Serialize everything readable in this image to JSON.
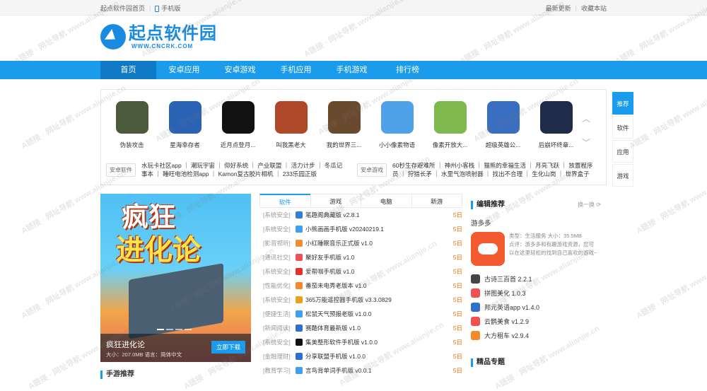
{
  "topbar": {
    "home_link": "起点软件园首页",
    "mobile_link": "手机版",
    "latest_link": "最新更新",
    "bookmark_link": "收藏本站"
  },
  "logo": {
    "name": "起点软件园",
    "url_text": "WWW.CNCRK.COM"
  },
  "nav": {
    "items": [
      "首页",
      "安卓应用",
      "安卓游戏",
      "手机应用",
      "手机游戏",
      "排行榜"
    ],
    "active": "首页"
  },
  "featured_apps": [
    {
      "name": "伪装攻击",
      "color": "#4a5a3a"
    },
    {
      "name": "星海幸存者",
      "color": "#2a62b4"
    },
    {
      "name": "近月点登月...",
      "color": "#111111"
    },
    {
      "name": "叫我黑老大",
      "color": "#b0482a"
    },
    {
      "name": "我的世界三...",
      "color": "#6a4a2f"
    },
    {
      "name": "小小像素物语",
      "color": "#4fa2e8"
    },
    {
      "name": "像素开放大...",
      "color": "#7fb84f"
    },
    {
      "name": "超级英雄公...",
      "color": "#3a6ec0"
    },
    {
      "name": "后崩坏终章...",
      "color": "#1e2c4a"
    }
  ],
  "tag_rows": [
    {
      "label": "安卓软件",
      "text": "水玩卡社区app ｜ 潮玩宇宙 ｜ 仰好系统 ｜ 产业联盟 ｜ 活力计步 ｜ 冬瓜记事本 ｜ 睡旺电池检测app ｜ Kamon复古胶片相机 ｜ 233乐园正版"
    },
    {
      "label": "安卓游戏",
      "text": "60秒生存避难所 ｜ 神州小客栈 ｜ 猫熊的幸福生活 ｜ 月亮飞跃 ｜ 放置程序员 ｜ 狩猎长矛 ｜ 水里气泡喷射器 ｜ 找出不合理 ｜ 生化山岗 ｜ 世界盒子"
    }
  ],
  "side_tabs": [
    "推荐",
    "软件",
    "应用",
    "游戏"
  ],
  "banner": {
    "title_line1": "疯狂",
    "title_line2": "进化论",
    "caption": "疯狂进化论",
    "meta": "大小：207.0MB   语言：简体中文",
    "download": "立即下载"
  },
  "list_tabs": [
    "软件",
    "游戏",
    "电脑",
    "新游"
  ],
  "list_items": [
    {
      "cat": "[系统安全]",
      "name": "笔趣阁典藏版 v2.8.1",
      "date": "5日",
      "color": "#2e7fd8"
    },
    {
      "cat": "[系统安全]",
      "name": "小熊画画手机版 v20240219.1",
      "date": "5日",
      "color": "#3aa0f0"
    },
    {
      "cat": "[影音视听]",
      "name": "小红睡眠音乐正式版 v1.0",
      "date": "5日",
      "color": "#f09030"
    },
    {
      "cat": "[通讯社交]",
      "name": "聚好友手机版 v1.0",
      "date": "5日",
      "color": "#f25050"
    },
    {
      "cat": "[系统安全]",
      "name": "爱帮咖手机版 v1.0",
      "date": "5日",
      "color": "#e83030"
    },
    {
      "cat": "[性能优化]",
      "name": "番茄未电秀老版本 v1.0",
      "date": "5日",
      "color": "#f08a2a"
    },
    {
      "cat": "[系统安全]",
      "name": "365万能遥控器手机版 v3.3.0829",
      "date": "5日",
      "color": "#e8a21a"
    },
    {
      "cat": "[便捷生活]",
      "name": "松鼠天气预报老版 v1.0.0",
      "date": "5日",
      "color": "#3aa0f0"
    },
    {
      "cat": "[新闻阅读]",
      "name": "赛酷体育最新版 v1.0",
      "date": "5日",
      "color": "#2e6fd0"
    },
    {
      "cat": "[系统安全]",
      "name": "集美整形软件手机版 v1.0.0",
      "date": "5日",
      "color": "#111111"
    },
    {
      "cat": "[金融理财]",
      "name": "分享联盟手机版 v1.0.0",
      "date": "5日",
      "color": "#2e6fd0"
    },
    {
      "cat": "[教育学习]",
      "name": "言鸟背单词手机版 v0.0.1",
      "date": "5日",
      "color": "#3aa0f0"
    }
  ],
  "editor": {
    "title": "编辑推荐",
    "swap": "换一换",
    "featured_name": "游多多",
    "featured_info": "类型：生活服务   大小：35.5MB",
    "featured_desc": "点评：游多多和有趣游戏资源，您可以在这里轻松的找到自己喜欢的游戏~",
    "items": [
      {
        "name": "古诗三百首 2.2.1",
        "color": "#444444"
      },
      {
        "name": "拼图美化 1.0.3",
        "color": "#f25050"
      },
      {
        "name": "邦元英语app v1.4.0",
        "color": "#2e6fd0"
      },
      {
        "name": "云鹊美食 v1.2.9",
        "color": "#f25050"
      },
      {
        "name": "大方租车 v2.9.4",
        "color": "#f08a2a"
      }
    ]
  },
  "special_title": "精品专题",
  "bottom_left_title": "手游推荐",
  "watermark": "A链接 · 网址导航  www.alianjie.cn"
}
